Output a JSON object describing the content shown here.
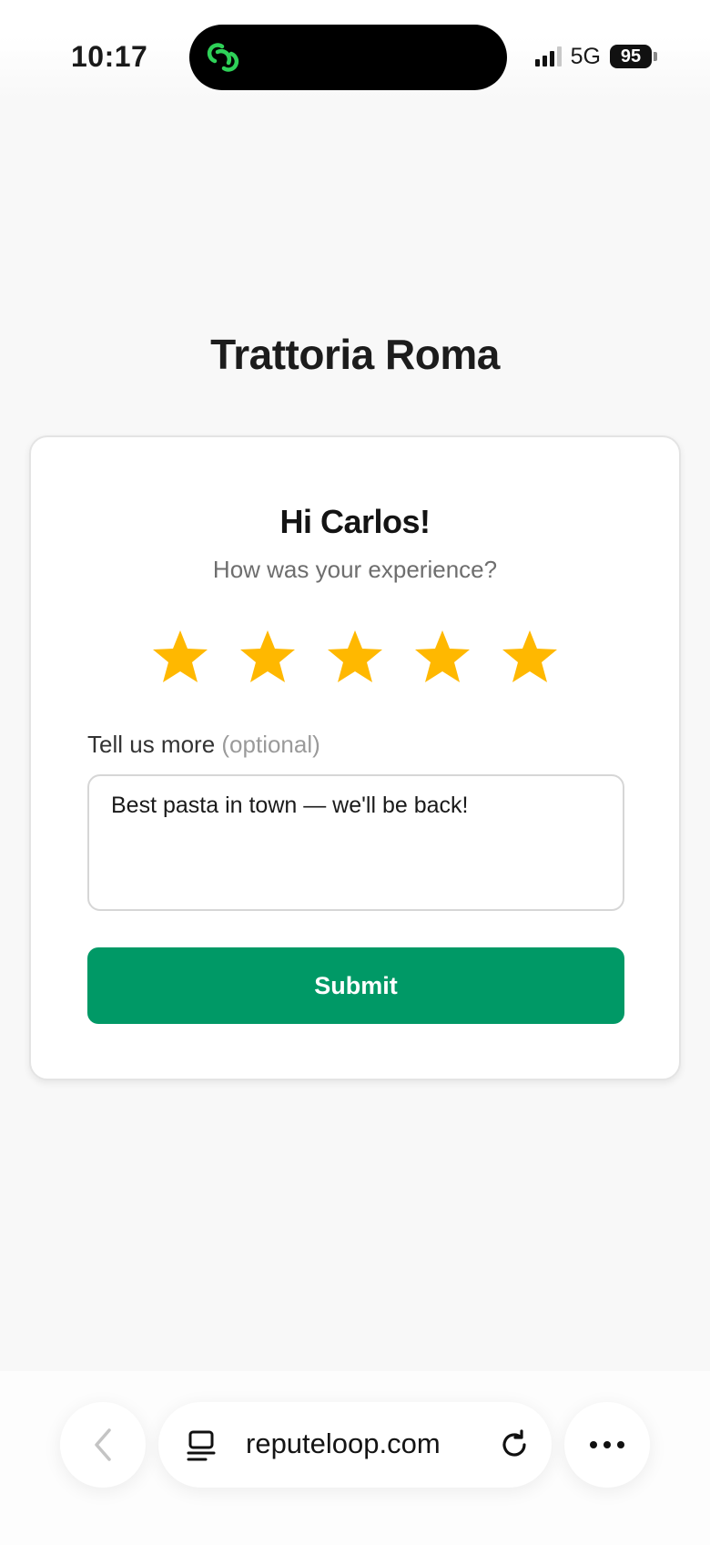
{
  "status_bar": {
    "time": "10:17",
    "network": "5G",
    "battery": "95",
    "app_icon": "link-icon"
  },
  "page": {
    "restaurant_name": "Trattoria Roma",
    "greeting": "Hi Carlos!",
    "question": "How was your experience?",
    "rating": {
      "value": 5,
      "max": 5,
      "star_color": "#ffb800"
    },
    "more_label": "Tell us more",
    "more_optional": "(optional)",
    "feedback_value": "Best pasta in town — we'll be back!",
    "submit_label": "Submit",
    "accent_color": "#009966"
  },
  "browser": {
    "url": "reputeloop.com",
    "icons": [
      "back-icon",
      "tabs-icon",
      "reload-icon",
      "more-icon"
    ]
  }
}
